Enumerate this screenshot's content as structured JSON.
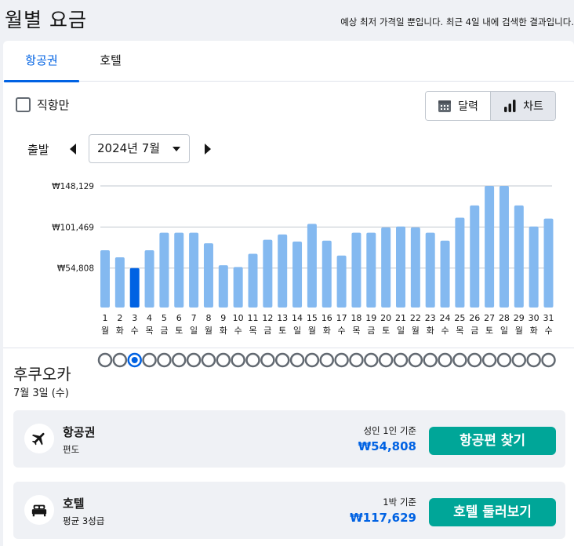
{
  "header": {
    "title": "월별 요금",
    "note": "예상 최저 가격일 뿐입니다. 최근 4일 내에 검색한 결과입니다."
  },
  "tabs": [
    {
      "label": "항공권",
      "active": true
    },
    {
      "label": "호텔",
      "active": false
    }
  ],
  "filters": {
    "direct_only_label": "직항만",
    "direct_only_checked": false
  },
  "view_toggle": {
    "calendar_label": "달력",
    "chart_label": "차트",
    "selected": "chart"
  },
  "departure": {
    "label": "출발",
    "month_value": "2024년 7월"
  },
  "chart_data": {
    "type": "bar",
    "y_tick_labels": [
      "₩148,129",
      "₩101,469",
      "₩54,808"
    ],
    "y_ticks": [
      148129,
      101469,
      54808
    ],
    "ylim": [
      10000,
      148129
    ],
    "categories": [
      "1",
      "2",
      "3",
      "4",
      "5",
      "6",
      "7",
      "8",
      "9",
      "10",
      "11",
      "12",
      "13",
      "14",
      "15",
      "16",
      "17",
      "18",
      "19",
      "20",
      "21",
      "22",
      "23",
      "24",
      "25",
      "26",
      "27",
      "28",
      "29",
      "30",
      "31"
    ],
    "weekdays": [
      "월",
      "화",
      "수",
      "목",
      "금",
      "토",
      "일",
      "월",
      "화",
      "수",
      "목",
      "금",
      "토",
      "일",
      "월",
      "화",
      "수",
      "목",
      "금",
      "토",
      "일",
      "월",
      "화",
      "수",
      "목",
      "금",
      "토",
      "일",
      "월",
      "화",
      "수"
    ],
    "values": [
      75000,
      67000,
      54808,
      75000,
      95000,
      95000,
      95000,
      83000,
      58000,
      56000,
      71000,
      87000,
      93000,
      85000,
      105000,
      86000,
      69000,
      95000,
      95000,
      101000,
      102000,
      101000,
      95000,
      86000,
      112000,
      126000,
      148129,
      148129,
      126000,
      102000,
      111000
    ],
    "selected_index": 2,
    "colors": {
      "bar": "#84b9f0",
      "bar_selected": "#0062e3",
      "gridline": "#c1c7cf",
      "dot_ring": "#626971"
    }
  },
  "destination": {
    "name": "후쿠오카",
    "date": "7월 3일 (수)"
  },
  "results": {
    "flight": {
      "icon": "airplane-icon",
      "title": "항공권",
      "subtitle": "편도",
      "basis": "성인 1인 기준",
      "price": "₩54,808",
      "button_label": "항공편 찾기"
    },
    "hotel": {
      "icon": "bed-icon",
      "title": "호텔",
      "subtitle": "평균 3성급",
      "basis": "1박 기준",
      "price": "₩117,629",
      "button_label": "호텔 둘러보기"
    }
  },
  "colors": {
    "accent": "#0062e3",
    "cta": "#00a698",
    "background": "#eff1f5"
  }
}
